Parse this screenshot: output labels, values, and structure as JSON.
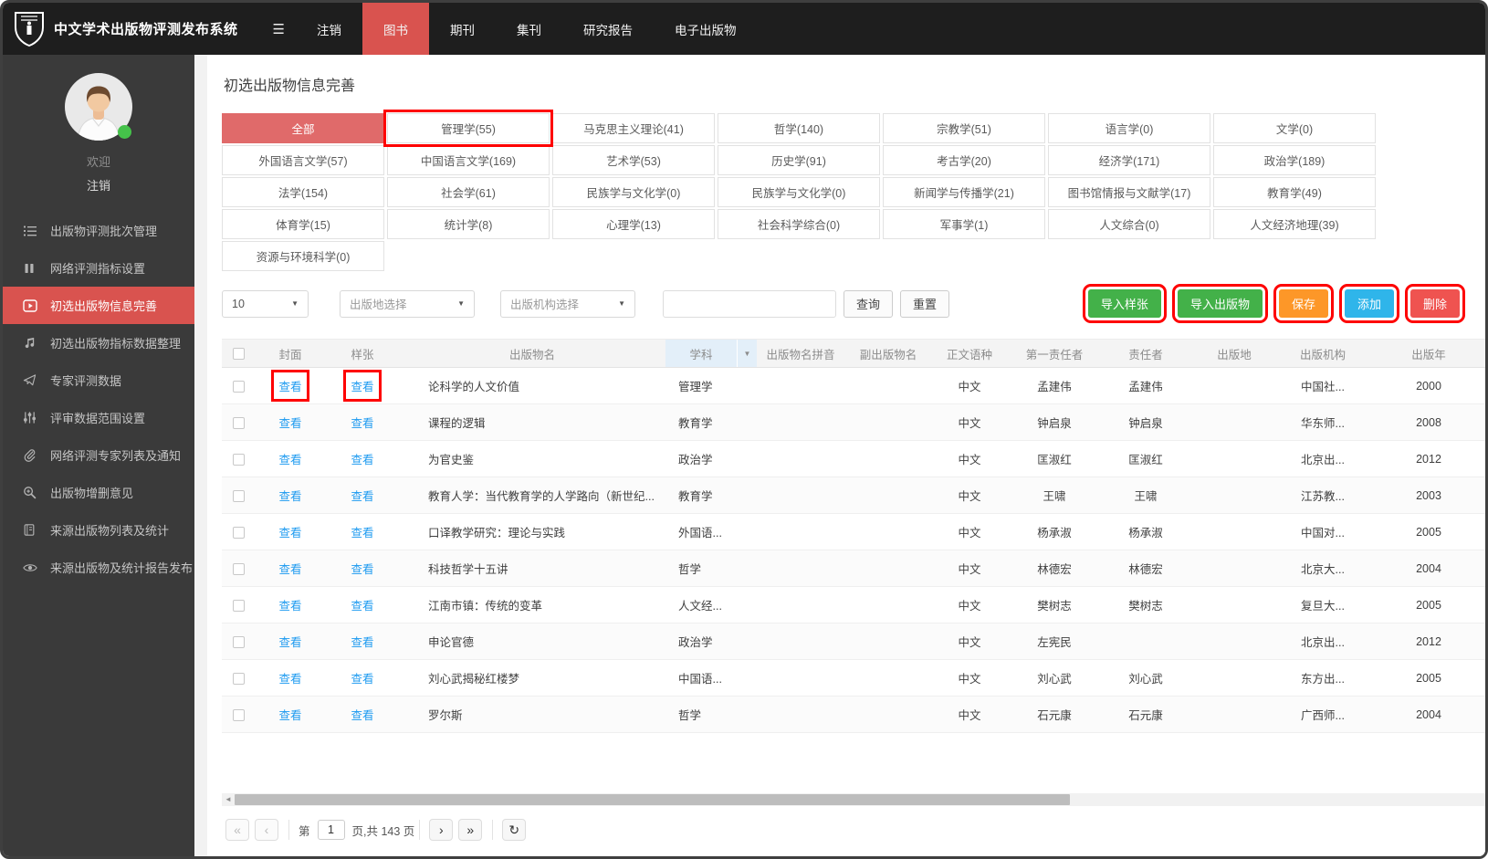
{
  "navbar": {
    "title": "中文学术出版物评测发布系统",
    "items": [
      {
        "label": "注销",
        "active": false
      },
      {
        "label": "图书",
        "active": true
      },
      {
        "label": "期刊",
        "active": false
      },
      {
        "label": "集刊",
        "active": false
      },
      {
        "label": "研究报告",
        "active": false
      },
      {
        "label": "电子出版物",
        "active": false
      }
    ]
  },
  "sidebar": {
    "welcome": "欢迎",
    "logout": "注销",
    "items": [
      {
        "icon": "list-icon",
        "label": "出版物评测批次管理",
        "active": false
      },
      {
        "icon": "bars-icon",
        "label": "网络评测指标设置",
        "active": false
      },
      {
        "icon": "play-icon",
        "label": "初选出版物信息完善",
        "active": true
      },
      {
        "icon": "music-note-icon",
        "label": "初选出版物指标数据整理",
        "active": false
      },
      {
        "icon": "paper-plane-icon",
        "label": "专家评测数据",
        "active": false
      },
      {
        "icon": "sliders-icon",
        "label": "评审数据范围设置",
        "active": false
      },
      {
        "icon": "paperclip-icon",
        "label": "网络评测专家列表及通知",
        "active": false
      },
      {
        "icon": "zoom-in-icon",
        "label": "出版物增删意见",
        "active": false
      },
      {
        "icon": "journal-icon",
        "label": "来源出版物列表及统计",
        "active": false
      },
      {
        "icon": "eye-icon",
        "label": "来源出版物及统计报告发布",
        "active": false
      }
    ]
  },
  "main": {
    "page_title": "初选出版物信息完善",
    "categories": [
      {
        "label": "全部",
        "active": true,
        "annotated": false
      },
      {
        "label": "管理学(55)",
        "active": false,
        "annotated": true
      },
      {
        "label": "马克思主义理论(41)",
        "active": false,
        "annotated": false
      },
      {
        "label": "哲学(140)",
        "active": false,
        "annotated": false
      },
      {
        "label": "宗教学(51)",
        "active": false,
        "annotated": false
      },
      {
        "label": "语言学(0)",
        "active": false,
        "annotated": false
      },
      {
        "label": "文学(0)",
        "active": false,
        "annotated": false
      },
      {
        "label": "外国语言文学(57)",
        "active": false,
        "annotated": false
      },
      {
        "label": "中国语言文学(169)",
        "active": false,
        "annotated": false
      },
      {
        "label": "艺术学(53)",
        "active": false,
        "annotated": false
      },
      {
        "label": "历史学(91)",
        "active": false,
        "annotated": false
      },
      {
        "label": "考古学(20)",
        "active": false,
        "annotated": false
      },
      {
        "label": "经济学(171)",
        "active": false,
        "annotated": false
      },
      {
        "label": "政治学(189)",
        "active": false,
        "annotated": false
      },
      {
        "label": "法学(154)",
        "active": false,
        "annotated": false
      },
      {
        "label": "社会学(61)",
        "active": false,
        "annotated": false
      },
      {
        "label": "民族学与文化学(0)",
        "active": false,
        "annotated": false
      },
      {
        "label": "民族学与文化学(0)",
        "active": false,
        "annotated": false
      },
      {
        "label": "新闻学与传播学(21)",
        "active": false,
        "annotated": false
      },
      {
        "label": "图书馆情报与文献学(17)",
        "active": false,
        "annotated": false
      },
      {
        "label": "教育学(49)",
        "active": false,
        "annotated": false
      },
      {
        "label": "体育学(15)",
        "active": false,
        "annotated": false
      },
      {
        "label": "统计学(8)",
        "active": false,
        "annotated": false
      },
      {
        "label": "心理学(13)",
        "active": false,
        "annotated": false
      },
      {
        "label": "社会科学综合(0)",
        "active": false,
        "annotated": false
      },
      {
        "label": "军事学(1)",
        "active": false,
        "annotated": false
      },
      {
        "label": "人文综合(0)",
        "active": false,
        "annotated": false
      },
      {
        "label": "人文经济地理(39)",
        "active": false,
        "annotated": false
      },
      {
        "label": "资源与环境科学(0)",
        "active": false,
        "annotated": false
      }
    ],
    "toolbar": {
      "page_size": "10",
      "place_select": "出版地选择",
      "org_select": "出版机构选择",
      "search_value": "",
      "query_label": "查询",
      "reset_label": "重置",
      "actions": [
        {
          "label": "导入样张",
          "color": "#43b149",
          "annotated": true
        },
        {
          "label": "导入出版物",
          "color": "#43b149",
          "annotated": true
        },
        {
          "label": "保存",
          "color": "#fd9728",
          "annotated": true
        },
        {
          "label": "添加",
          "color": "#2fb5ea",
          "annotated": true
        },
        {
          "label": "删除",
          "color": "#ef5350",
          "annotated": true
        }
      ]
    },
    "table": {
      "headers": [
        "封面",
        "样张",
        "出版物名",
        "学科",
        "出版物名拼音",
        "副出版物名",
        "正文语种",
        "第一责任者",
        "责任者",
        "出版地",
        "出版机构",
        "出版年"
      ],
      "view_label": "查看",
      "rows": [
        {
          "name": "论科学的人文价值",
          "subject": "管理学",
          "pinyin": "",
          "sub_name": "",
          "lang": "中文",
          "first_author": "孟建伟",
          "author": "孟建伟",
          "place": "",
          "org": "中国社...",
          "year": "2000",
          "annotated": true
        },
        {
          "name": "课程的逻辑",
          "subject": "教育学",
          "pinyin": "",
          "sub_name": "",
          "lang": "中文",
          "first_author": "钟启泉",
          "author": "钟启泉",
          "place": "",
          "org": "华东师...",
          "year": "2008",
          "annotated": false
        },
        {
          "name": "为官史鉴",
          "subject": "政治学",
          "pinyin": "",
          "sub_name": "",
          "lang": "中文",
          "first_author": "匡淑红",
          "author": "匡淑红",
          "place": "",
          "org": "北京出...",
          "year": "2012",
          "annotated": false
        },
        {
          "name": "教育人学：当代教育学的人学路向（新世纪...",
          "subject": "教育学",
          "pinyin": "",
          "sub_name": "",
          "lang": "中文",
          "first_author": "王啸",
          "author": "王啸",
          "place": "",
          "org": "江苏教...",
          "year": "2003",
          "annotated": false
        },
        {
          "name": "口译教学研究：理论与实践",
          "subject": "外国语...",
          "pinyin": "",
          "sub_name": "",
          "lang": "中文",
          "first_author": "杨承淑",
          "author": "杨承淑",
          "place": "",
          "org": "中国对...",
          "year": "2005",
          "annotated": false
        },
        {
          "name": "科技哲学十五讲",
          "subject": "哲学",
          "pinyin": "",
          "sub_name": "",
          "lang": "中文",
          "first_author": "林德宏",
          "author": "林德宏",
          "place": "",
          "org": "北京大...",
          "year": "2004",
          "annotated": false
        },
        {
          "name": "江南市镇：传统的变革",
          "subject": "人文经...",
          "pinyin": "",
          "sub_name": "",
          "lang": "中文",
          "first_author": "樊树志",
          "author": "樊树志",
          "place": "",
          "org": "复旦大...",
          "year": "2005",
          "annotated": false
        },
        {
          "name": "申论官德",
          "subject": "政治学",
          "pinyin": "",
          "sub_name": "",
          "lang": "中文",
          "first_author": "左宪民",
          "author": "",
          "place": "",
          "org": "北京出...",
          "year": "2012",
          "annotated": false
        },
        {
          "name": "刘心武揭秘红楼梦",
          "subject": "中国语...",
          "pinyin": "",
          "sub_name": "",
          "lang": "中文",
          "first_author": "刘心武",
          "author": "刘心武",
          "place": "",
          "org": "东方出...",
          "year": "2005",
          "annotated": false
        },
        {
          "name": "罗尔斯",
          "subject": "哲学",
          "pinyin": "",
          "sub_name": "",
          "lang": "中文",
          "first_author": "石元康",
          "author": "石元康",
          "place": "",
          "org": "广西师...",
          "year": "2004",
          "annotated": false
        }
      ]
    },
    "pagination": {
      "first": "«",
      "prev": "‹",
      "page_prefix": "第",
      "current_page": "1",
      "page_suffix": "页,共 143 页",
      "next": "›",
      "last": "»",
      "refresh": "↻"
    }
  },
  "colors": {
    "navbar_active": "#d9534f",
    "sidebar_active": "#d9534f",
    "category_active_bg": "#e06a6a",
    "link": "#1f9bf0",
    "annotation": "#fe0000"
  }
}
